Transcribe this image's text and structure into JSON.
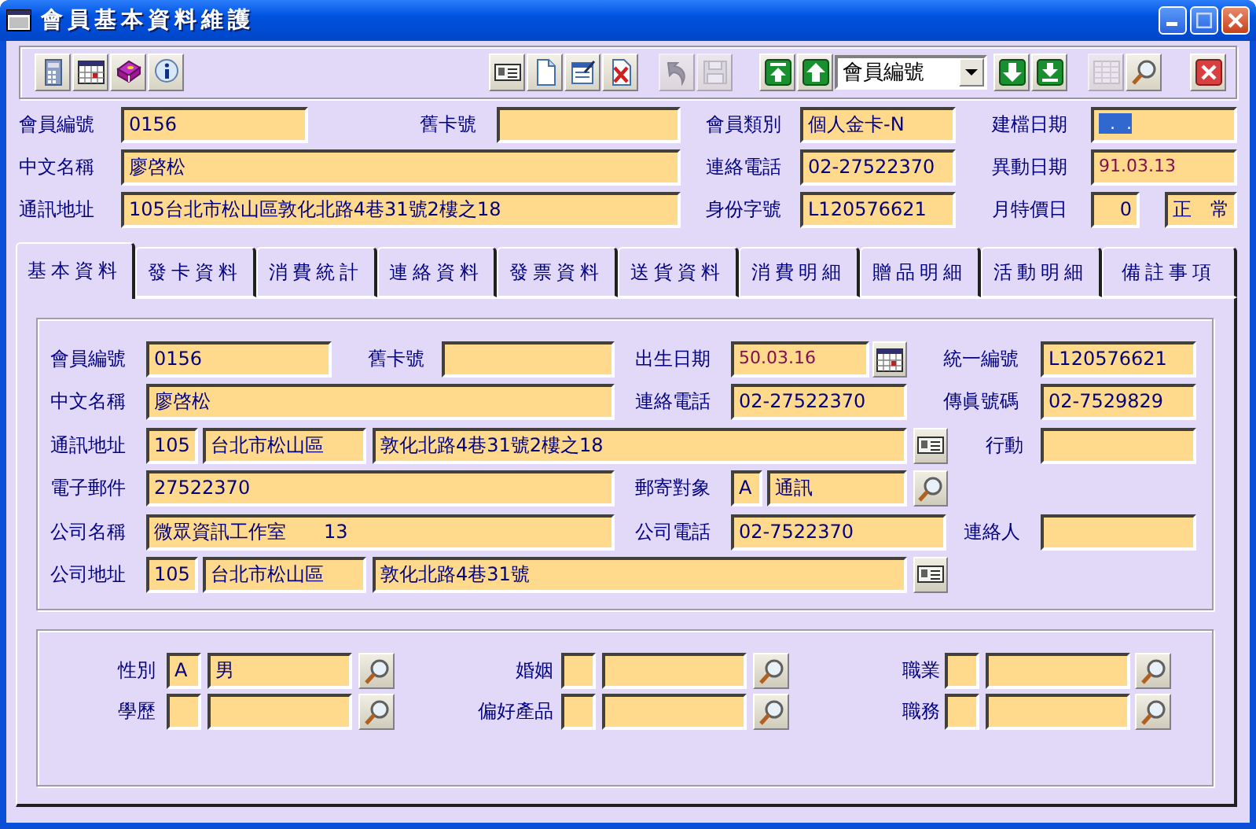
{
  "window": {
    "title": "會員基本資料維護"
  },
  "toolbar": {
    "items": [
      {
        "kind": "calculator",
        "disabled": false
      },
      {
        "kind": "calendar",
        "disabled": false
      },
      {
        "kind": "book",
        "disabled": false
      },
      {
        "kind": "info",
        "disabled": false
      },
      {
        "kind": "card",
        "disabled": false
      },
      {
        "kind": "document",
        "disabled": false
      },
      {
        "kind": "edit-document",
        "disabled": false
      },
      {
        "kind": "delete-document",
        "disabled": false
      },
      {
        "kind": "undo",
        "disabled": true
      },
      {
        "kind": "save",
        "disabled": true
      },
      {
        "kind": "first",
        "disabled": false
      },
      {
        "kind": "previous",
        "disabled": false
      },
      {
        "kind": "select",
        "value": "會員編號"
      },
      {
        "kind": "next",
        "disabled": false
      },
      {
        "kind": "last",
        "disabled": false
      },
      {
        "kind": "grid",
        "disabled": true
      },
      {
        "kind": "search",
        "disabled": false
      },
      {
        "kind": "close",
        "disabled": false
      }
    ]
  },
  "header": {
    "rows": [
      {
        "fields": [
          {
            "label": "會員編號",
            "inputs": [
              {
                "kind": "text",
                "value": "0156"
              }
            ]
          },
          {
            "label": "舊卡號",
            "inputs": [
              {
                "kind": "text"
              }
            ]
          },
          {
            "label": "會員類別",
            "inputs": [
              {
                "kind": "text",
                "value": "個人金卡-N"
              }
            ]
          },
          {
            "label": "建檔日期",
            "inputs": [
              {
                "kind": "date",
                "value": "  .  .",
                "highlighted": true
              }
            ]
          }
        ]
      },
      {
        "fields": [
          {
            "label": "中文名稱",
            "inputs": [
              {
                "kind": "text",
                "value": "廖啓松"
              }
            ]
          },
          {
            "label": "連絡電話",
            "inputs": [
              {
                "kind": "text",
                "value": "02-27522370"
              }
            ]
          },
          {
            "label": "異動日期",
            "inputs": [
              {
                "kind": "date",
                "value": "91.03.13",
                "highlighted": false
              }
            ]
          }
        ]
      },
      {
        "fields": [
          {
            "label": "通訊地址",
            "inputs": [
              {
                "kind": "text",
                "value": "105台北市松山區敦化北路4巷31號2樓之18"
              }
            ]
          },
          {
            "label": "身份字號",
            "inputs": [
              {
                "kind": "text",
                "value": "L120576621"
              }
            ]
          },
          {
            "label": "月特價日",
            "inputs": [
              {
                "kind": "number",
                "value": "0"
              },
              {
                "kind": "text",
                "value": "正　常"
              }
            ]
          }
        ]
      }
    ]
  },
  "tabs": [
    {
      "label": "基本資料",
      "selected": true
    },
    {
      "label": "發卡資料",
      "selected": false
    },
    {
      "label": "消費統計",
      "selected": false
    },
    {
      "label": "連絡資料",
      "selected": false
    },
    {
      "label": "發票資料",
      "selected": false
    },
    {
      "label": "送貨資料",
      "selected": false
    },
    {
      "label": "消費明細",
      "selected": false
    },
    {
      "label": "贈品明細",
      "selected": false
    },
    {
      "label": "活動明細",
      "selected": false
    },
    {
      "label": "備註事項",
      "selected": false
    }
  ],
  "basic_info": {
    "rows": [
      {
        "fields": [
          {
            "label": "會員編號",
            "inputs": [
              {
                "kind": "text",
                "value": "0156"
              }
            ]
          },
          {
            "label": "舊卡號",
            "inputs": [
              {
                "kind": "text"
              }
            ]
          },
          {
            "label": "出生日期",
            "inputs": [
              {
                "kind": "date",
                "value": "50.03.16",
                "highlighted": false
              },
              {
                "kind": "calendar-button"
              }
            ]
          },
          {
            "label": "統一編號",
            "inputs": [
              {
                "kind": "text",
                "value": "L120576621"
              }
            ]
          }
        ]
      },
      {
        "fields": [
          {
            "label": "中文名稱",
            "inputs": [
              {
                "kind": "text",
                "value": "廖啓松"
              }
            ]
          },
          {
            "label": "連絡電話",
            "inputs": [
              {
                "kind": "text",
                "value": "02-27522370"
              }
            ]
          },
          {
            "label": "傳眞號碼",
            "inputs": [
              {
                "kind": "text",
                "value": "02-7529829"
              }
            ]
          }
        ]
      },
      {
        "fields": [
          {
            "label": "通訊地址",
            "inputs": [
              {
                "kind": "text",
                "value": "105"
              },
              {
                "kind": "text",
                "value": "台北市松山區"
              },
              {
                "kind": "text",
                "value": "敦化北路4巷31號2樓之18"
              },
              {
                "kind": "card-button"
              }
            ]
          },
          {
            "label": "行動",
            "inputs": [
              {
                "kind": "text"
              }
            ]
          }
        ]
      },
      {
        "fields": [
          {
            "label": "電子郵件",
            "inputs": [
              {
                "kind": "text",
                "value": "27522370"
              }
            ]
          },
          {
            "label": "郵寄對象",
            "inputs": [
              {
                "kind": "text",
                "value": "A"
              },
              {
                "kind": "text",
                "value": "通訊"
              },
              {
                "kind": "search-button"
              }
            ]
          }
        ]
      },
      {
        "fields": [
          {
            "label": "公司名稱",
            "inputs": [
              {
                "kind": "text",
                "value": "微眾資訊工作室　　13"
              }
            ]
          },
          {
            "label": "公司電話",
            "inputs": [
              {
                "kind": "text",
                "value": "02-7522370"
              }
            ]
          },
          {
            "label": "連絡人",
            "inputs": [
              {
                "kind": "text"
              }
            ]
          }
        ]
      },
      {
        "fields": [
          {
            "label": "公司地址",
            "inputs": [
              {
                "kind": "text",
                "value": "105"
              },
              {
                "kind": "text",
                "value": "台北市松山區"
              },
              {
                "kind": "text",
                "value": "敦化北路4巷31號"
              },
              {
                "kind": "card-button"
              }
            ]
          }
        ]
      }
    ]
  },
  "profile": {
    "rows": [
      {
        "fields": [
          {
            "label": "性別",
            "inputs": [
              {
                "kind": "text",
                "value": "A"
              },
              {
                "kind": "text",
                "value": "男"
              },
              {
                "kind": "search-button"
              }
            ]
          },
          {
            "label": "婚姻",
            "inputs": [
              {
                "kind": "text"
              },
              {
                "kind": "text"
              },
              {
                "kind": "search-button"
              }
            ]
          },
          {
            "label": "職業",
            "inputs": [
              {
                "kind": "text"
              },
              {
                "kind": "text"
              },
              {
                "kind": "search-button"
              }
            ]
          }
        ]
      },
      {
        "fields": [
          {
            "label": "學歷",
            "inputs": [
              {
                "kind": "text"
              },
              {
                "kind": "text"
              },
              {
                "kind": "search-button"
              }
            ]
          },
          {
            "label": "偏好產品",
            "inputs": [
              {
                "kind": "text"
              },
              {
                "kind": "text"
              },
              {
                "kind": "search-button"
              }
            ]
          },
          {
            "label": "職務",
            "inputs": [
              {
                "kind": "text"
              },
              {
                "kind": "text"
              },
              {
                "kind": "search-button"
              }
            ]
          }
        ]
      }
    ]
  }
}
